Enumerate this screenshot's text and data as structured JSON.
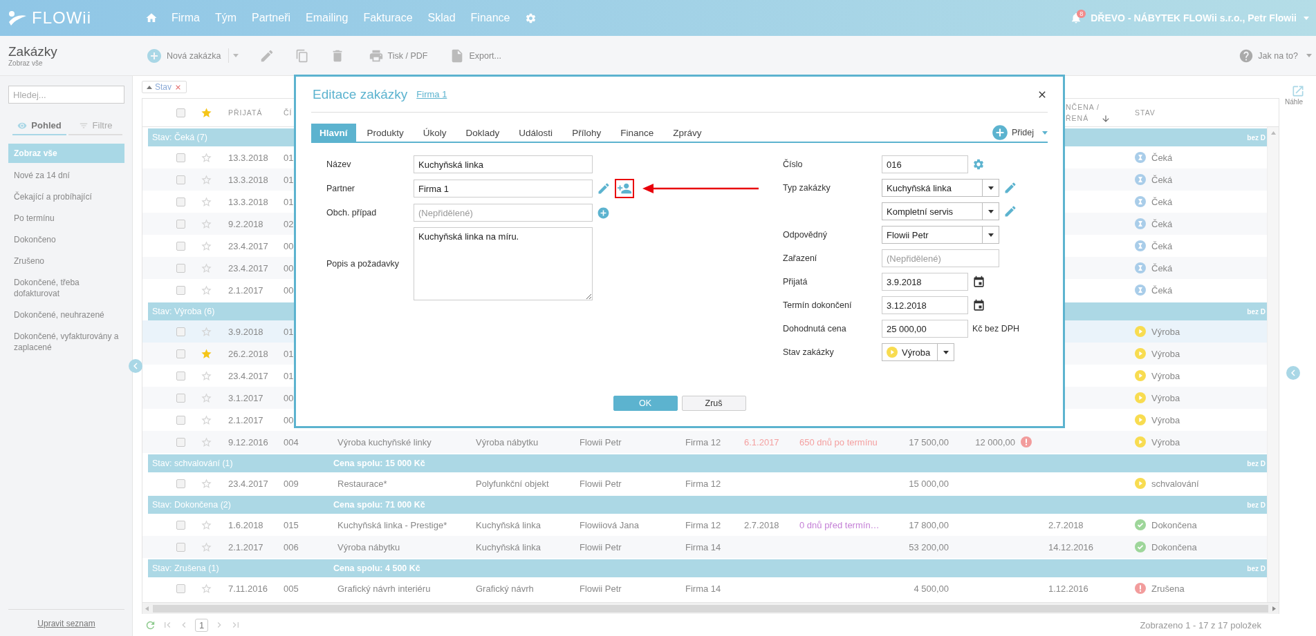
{
  "app": {
    "logo": "FLOWii",
    "nav": [
      {
        "label": "Firma"
      },
      {
        "label": "Tým"
      },
      {
        "label": "Partneři"
      },
      {
        "label": "Emailing"
      },
      {
        "label": "Fakturace"
      },
      {
        "label": "Sklad"
      },
      {
        "label": "Finance"
      }
    ],
    "notifications": "8",
    "account": "DŘEVO - NÁBYTEK FLOWii s.r.o., Petr Flowii"
  },
  "toolbar": {
    "title": "Zakázky",
    "subtitle": "Zobraz vše",
    "new": "Nová zakázka",
    "print": "Tisk / PDF",
    "export": "Export...",
    "help": "Jak na to?"
  },
  "sidebar": {
    "search_placeholder": "Hledej...",
    "tabs": [
      {
        "label": "Pohled",
        "kind": "view",
        "selected": true
      },
      {
        "label": "Filtre",
        "kind": "filter",
        "selected": false
      }
    ],
    "items": [
      {
        "label": "Zobraz vše",
        "selected": true
      },
      {
        "label": "Nové za 14 dní",
        "selected": false
      },
      {
        "label": "Čekající a probíhající",
        "selected": false
      },
      {
        "label": "Po termínu",
        "selected": false
      },
      {
        "label": "Dokončeno",
        "selected": false
      },
      {
        "label": "Zrušeno",
        "selected": false
      },
      {
        "label": "Dokončené, třeba dofakturovat",
        "selected": false
      },
      {
        "label": "Dokončené, neuhrazené",
        "selected": false
      },
      {
        "label": "Dokončené, vyfakturovány a zaplacené",
        "selected": false
      }
    ],
    "edit_link": "Upravit seznam"
  },
  "filters": [
    {
      "label": "Stav"
    }
  ],
  "table": {
    "headers": {
      "checked": false,
      "received": "PŘIJATÁ",
      "number": "ČÍ",
      "finished": [
        "NČENA /",
        "ŘENÁ"
      ],
      "finished_sorted": true,
      "status": "STAV"
    },
    "groups": [
      {
        "title": "Stav: Čeká (7)",
        "note": "bez D",
        "rows": [
          {
            "received": "13.3.2018",
            "number": "01",
            "status": {
              "text": "Čeká",
              "kind": "waiting"
            },
            "checked": false,
            "starred": false,
            "selected": false
          },
          {
            "received": "13.3.2018",
            "number": "01",
            "status": {
              "text": "Čeká",
              "kind": "waiting"
            },
            "checked": false,
            "starred": false,
            "selected": false
          },
          {
            "received": "13.3.2018",
            "number": "01",
            "status": {
              "text": "Čeká",
              "kind": "waiting"
            },
            "checked": false,
            "starred": false,
            "selected": false
          },
          {
            "received": "9.2.2018",
            "number": "02",
            "status": {
              "text": "Čeká",
              "kind": "waiting"
            },
            "checked": false,
            "starred": false,
            "selected": false
          },
          {
            "received": "23.4.2017",
            "number": "00",
            "status": {
              "text": "Čeká",
              "kind": "waiting"
            },
            "checked": false,
            "starred": false,
            "selected": false
          },
          {
            "received": "23.4.2017",
            "number": "00",
            "status": {
              "text": "Čeká",
              "kind": "waiting"
            },
            "checked": false,
            "starred": false,
            "selected": false
          },
          {
            "received": "2.1.2017",
            "number": "00",
            "status": {
              "text": "Čeká",
              "kind": "waiting"
            },
            "checked": false,
            "starred": false,
            "selected": false
          }
        ]
      },
      {
        "title": "Stav: Výroba (6)",
        "note": "bez D",
        "rows": [
          {
            "received": "3.9.2018",
            "number": "01",
            "status": {
              "text": "Výroba",
              "kind": "production"
            },
            "checked": false,
            "starred": false,
            "selected": true
          },
          {
            "received": "26.2.2018",
            "number": "01",
            "status": {
              "text": "Výroba",
              "kind": "production"
            },
            "checked": false,
            "starred": true,
            "selected": false
          },
          {
            "received": "23.4.2017",
            "number": "01",
            "status": {
              "text": "Výroba",
              "kind": "production"
            },
            "checked": false,
            "starred": false,
            "selected": false
          },
          {
            "received": "3.1.2017",
            "number": "00",
            "status": {
              "text": "Výroba",
              "kind": "production"
            },
            "checked": false,
            "starred": false,
            "selected": false
          },
          {
            "received": "2.1.2017",
            "number": "00",
            "status": {
              "text": "Výroba",
              "kind": "production"
            },
            "checked": false,
            "starred": false,
            "selected": false
          },
          {
            "received": "9.12.2016",
            "number": "004",
            "name": "Výroba kuchyňské linky",
            "type": "Výroba nábytku",
            "owner": "Flowii Petr",
            "partner": "Firma 12",
            "deadline": {
              "text": "6.1.2017",
              "overdue": true
            },
            "remaining": {
              "text": "650 dnů po termínu",
              "kind": "overdue"
            },
            "price": "17 500,00",
            "invoiced": {
              "value": "12 000,00",
              "alert": true
            },
            "status": {
              "text": "Výroba",
              "kind": "production"
            },
            "checked": false,
            "starred": false,
            "selected": false
          }
        ]
      },
      {
        "title": "Stav: schvalování (1)",
        "total": "Cena spolu: **15 000 Kč**",
        "note": "bez D",
        "rows": [
          {
            "received": "23.4.2017",
            "number": "009",
            "name": "Restaurace*",
            "type": "Polyfunkční objekt",
            "owner": "Flowii Petr",
            "partner": "Firma 12",
            "price": "15 000,00",
            "status": {
              "text": "schvalování",
              "kind": "production"
            },
            "checked": false,
            "starred": false,
            "selected": false
          }
        ]
      },
      {
        "title": "Stav: Dokončena (2)",
        "total": "Cena spolu: **71 000 Kč**",
        "note": "bez D",
        "rows": [
          {
            "received": "1.6.2018",
            "number": "015",
            "name": "Kuchyňská linka - Prestige*",
            "type": "Kuchyňská linka",
            "owner": "Flowiiová Jana",
            "partner": "Firma 12",
            "deadline": {
              "text": "2.7.2018",
              "overdue": false
            },
            "remaining": {
              "text": "0 dnů před termín…",
              "kind": "soon"
            },
            "price": "17 800,00",
            "finished": "2.7.2018",
            "status": {
              "text": "Dokončena",
              "kind": "done"
            },
            "checked": false,
            "starred": false,
            "selected": false
          },
          {
            "received": "2.1.2017",
            "number": "006",
            "name": "Výroba nábytku",
            "type": "Kuchyňská linka",
            "owner": "Flowii Petr",
            "partner": "Firma 14",
            "price": "53 200,00",
            "finished": "14.12.2016",
            "status": {
              "text": "Dokončena",
              "kind": "done"
            },
            "checked": false,
            "starred": false,
            "selected": false
          }
        ]
      },
      {
        "title": "Stav: Zrušena (1)",
        "total": "Cena spolu: **4 500 Kč**",
        "note": "bez D",
        "rows": [
          {
            "received": "7.11.2016",
            "number": "005",
            "name": "Grafický návrh interiéru",
            "type": "Grafický návrh",
            "owner": "Flowii Petr",
            "partner": "Firma 14",
            "price": "4 500,00",
            "finished": "1.12.2016",
            "status": {
              "text": "Zrušena",
              "kind": "cancelled"
            },
            "checked": false,
            "starred": false,
            "selected": false
          }
        ]
      }
    ]
  },
  "pager": {
    "page": "1",
    "summary": "Zobrazeno 1 - 17 z 17 položek"
  },
  "preview": {
    "label": "Náhle"
  },
  "dialog": {
    "title": "Editace zakázky",
    "link": "Firma 1",
    "add": "Přidej",
    "tabs": [
      {
        "label": "Hlavní",
        "selected": true
      },
      {
        "label": "Produkty",
        "selected": false
      },
      {
        "label": "Úkoly",
        "selected": false
      },
      {
        "label": "Doklady",
        "selected": false
      },
      {
        "label": "Události",
        "selected": false
      },
      {
        "label": "Přílohy",
        "selected": false
      },
      {
        "label": "Finance",
        "selected": false
      },
      {
        "label": "Zprávy",
        "selected": false
      }
    ],
    "left": [
      {
        "kind": "input",
        "label": "Název",
        "value": "Kuchyňská linka"
      },
      {
        "kind": "input",
        "label": "Partner",
        "value": "Firma 1",
        "actions": [
          {
            "kind": "edit",
            "highlighted": false
          },
          {
            "kind": "add_person",
            "highlighted": true
          }
        ]
      },
      {
        "kind": "input",
        "label": "Obch. případ",
        "placeholder": "(Nepřidělené)",
        "actions": [
          {
            "kind": "add",
            "highlighted": false
          }
        ]
      },
      {
        "kind": "textarea",
        "label": "Popis a požadavky",
        "value": "Kuchyňská linka na míru."
      }
    ],
    "right": [
      {
        "kind": "short_input",
        "label": "Číslo",
        "value": "016",
        "actions": [
          {
            "kind": "settings",
            "highlighted": false
          }
        ]
      },
      {
        "kind": "select",
        "label": "Typ zakázky",
        "value": "Kuchyňská linka",
        "actions": [
          {
            "kind": "edit",
            "highlighted": false
          }
        ]
      },
      {
        "kind": "select",
        "value": "Kompletní servis",
        "actions": [
          {
            "kind": "edit",
            "highlighted": false
          }
        ]
      },
      {
        "kind": "select",
        "label": "Odpovědný",
        "value": "Flowii Petr"
      },
      {
        "kind": "input",
        "label": "Zařazení",
        "placeholder": "(Nepřidělené)"
      },
      {
        "kind": "short_input",
        "label": "Přijatá",
        "value": "3.9.2018",
        "actions": [
          {
            "kind": "calendar",
            "highlighted": false
          }
        ]
      },
      {
        "kind": "short_input",
        "label": "Termín dokončení",
        "value": "3.12.2018",
        "actions": [
          {
            "kind": "calendar",
            "highlighted": false
          }
        ]
      },
      {
        "kind": "short_input",
        "label": "Dohodnutá cena",
        "value": "25 000,00",
        "suffix": "Kč bez DPH"
      },
      {
        "kind": "status_select",
        "label": "Stav zakázky",
        "value": "Výroba",
        "state": {
          "kind": "production"
        }
      }
    ],
    "buttons": [
      {
        "label": "OK",
        "primary": true
      },
      {
        "label": "Zruš",
        "primary": false
      }
    ]
  }
}
